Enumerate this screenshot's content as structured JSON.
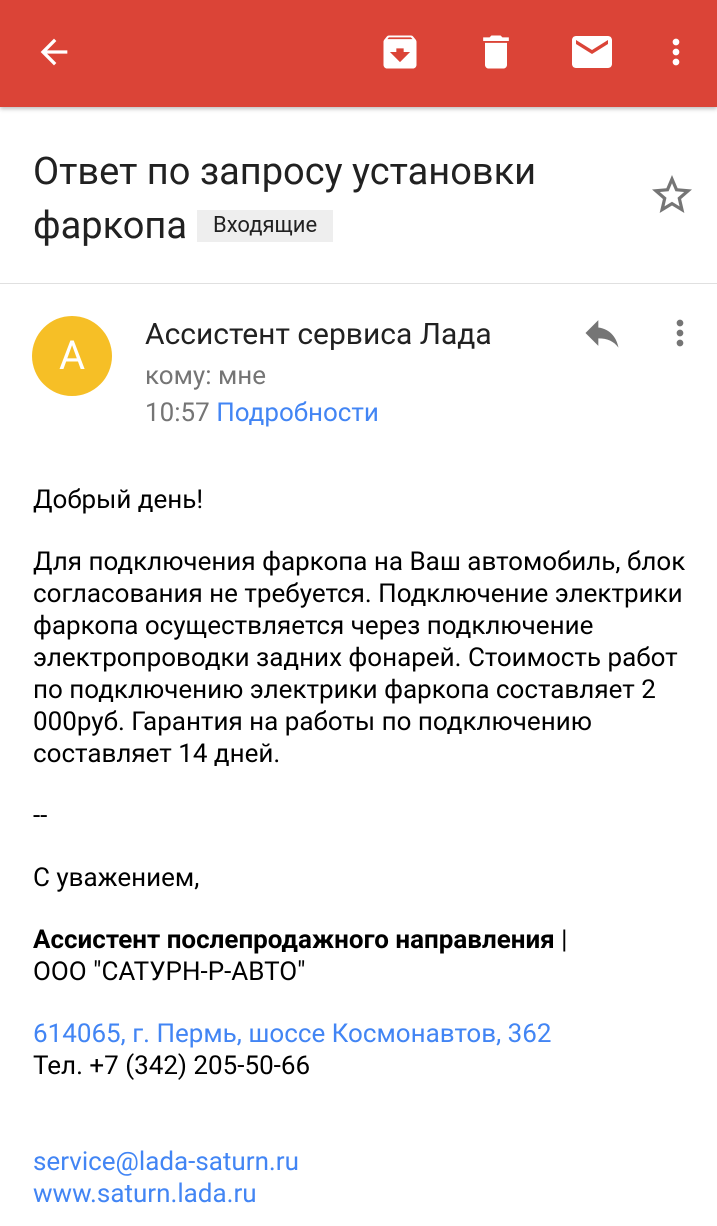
{
  "toolbar": {
    "bg_color": "#db4437",
    "icons": [
      "back-arrow-icon",
      "archive-icon",
      "trash-icon",
      "mail-icon",
      "more-vert-icon"
    ]
  },
  "email": {
    "subject": "Ответ по запросу установки фаркопа",
    "label": "Входящие"
  },
  "message": {
    "avatar_letter": "A",
    "avatar_color": "#f6bf26",
    "sender": "Ассистент сервиса Лада",
    "to": "кому: мне",
    "time": "10:57",
    "details_link": "Подробности",
    "greeting": "Добрый день!",
    "paragraph": "Для подключения фаркопа на Ваш автомобиль, блок согласования не требуется. Подключение электрики фаркопа осуществляется через подключение электропроводки задних фонарей. Стоимость работ по подключению электрики фаркопа составляет 2 000руб. Гарантия на работы по подключению составляет 14 дней.",
    "separator": "--",
    "regards": "С уважением,",
    "sig_title": "Ассистент послепродажного направления",
    "sig_pipe": " |",
    "sig_company": "ООО \"САТУРН-Р-АВТО\"",
    "address": "614065, г. Пермь, шоссе Космонавтов, 362",
    "phone": "Тел. +7 (342) 205-50-66",
    "email": "service@lada-saturn.ru",
    "website": "www.saturn.lada.ru"
  },
  "colors": {
    "link": "#4285f4",
    "secondary_text": "#757575"
  }
}
